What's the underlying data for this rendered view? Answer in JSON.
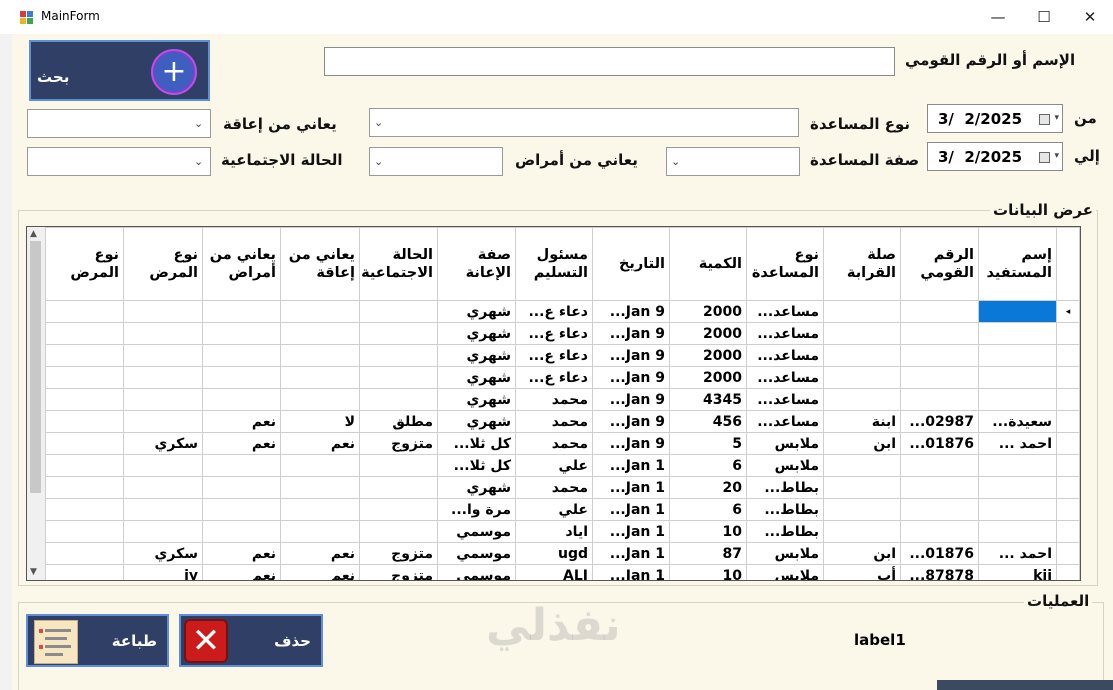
{
  "window": {
    "title": "MainForm",
    "minimize": "—",
    "maximize": "☐",
    "close": "✕"
  },
  "search": {
    "name_label": "الإسم أو الرقم القومي",
    "name_value": "",
    "button_label": "بحث",
    "from_label": "من",
    "to_label": "إلي",
    "from_date": "3/  2/2025",
    "to_date": "3/  2/2025",
    "aid_type_label": "نوع المساعدة",
    "aid_type_value": "",
    "aid_kind_label": "صفة المساعدة",
    "aid_kind_value": "",
    "disability_label": "يعاني من إعاقة",
    "disability_value": "",
    "disease_label": "يعاني من أمراض",
    "disease_value": "",
    "social_label": "الحالة الاجتماعية",
    "social_value": ""
  },
  "data_group_title": "عرض البيانات",
  "grid": {
    "columns": [
      "إسم المستفيد",
      "الرقم القومي",
      "صلة القرابة",
      "نوع المساعدة",
      "الكمية",
      "التاريخ",
      "مسئول التسليم",
      "صفة الإعانة",
      "الحالة الاجتماعية",
      "يعاني من إعاقة",
      "يعاني من أمراض",
      "نوع المرض",
      "نوع المرض"
    ],
    "rows": [
      [
        "",
        "",
        "",
        "مساعد...",
        "2000",
        "9  Jan...",
        "دعاء ع...",
        "شهري",
        "",
        "",
        "",
        "",
        ""
      ],
      [
        "",
        "",
        "",
        "مساعد...",
        "2000",
        "9  Jan...",
        "دعاء ع...",
        "شهري",
        "",
        "",
        "",
        "",
        ""
      ],
      [
        "",
        "",
        "",
        "مساعد...",
        "2000",
        "9  Jan...",
        "دعاء ع...",
        "شهري",
        "",
        "",
        "",
        "",
        ""
      ],
      [
        "",
        "",
        "",
        "مساعد...",
        "2000",
        "9  Jan...",
        "دعاء ع...",
        "شهري",
        "",
        "",
        "",
        "",
        ""
      ],
      [
        "",
        "",
        "",
        "مساعد...",
        "4345",
        "9  Jan...",
        "محمد",
        "شهري",
        "",
        "",
        "",
        "",
        ""
      ],
      [
        "سعيدة...",
        "02987...",
        "ابنة",
        "مساعد...",
        "456",
        "9  Jan...",
        "محمد",
        "شهري",
        "مطلق",
        "لا",
        "نعم",
        "",
        ""
      ],
      [
        "احمد ...",
        "01876...",
        "ابن",
        "ملابس",
        "5",
        "9  Jan...",
        "محمد",
        "كل ثلا...",
        "متزوج",
        "نعم",
        "نعم",
        "سكري",
        ""
      ],
      [
        "",
        "",
        "",
        "ملابس",
        "6",
        "1  Jan...",
        "علي",
        "كل ثلا...",
        "",
        "",
        "",
        "",
        ""
      ],
      [
        "",
        "",
        "",
        "بطاط...",
        "20",
        "1  Jan...",
        "محمد",
        "شهري",
        "",
        "",
        "",
        "",
        ""
      ],
      [
        "",
        "",
        "",
        "بطاط...",
        "6",
        "1  Jan...",
        "علي",
        "مرة وا...",
        "",
        "",
        "",
        "",
        ""
      ],
      [
        "",
        "",
        "",
        "بطاط...",
        "10",
        "1  Jan...",
        "اياد",
        "موسمي",
        "",
        "",
        "",
        "",
        ""
      ],
      [
        "احمد ...",
        "01876...",
        "ابن",
        "ملابس",
        "87",
        "1  Jan...",
        "ugd",
        "موسمي",
        "متزوج",
        "نعم",
        "نعم",
        "سكري",
        ""
      ],
      [
        "kii",
        "87878...",
        "أب",
        "ملابس",
        "10",
        "1  Jan...",
        "ALI",
        "موسمي",
        "متزوج",
        "نعم",
        "نعم",
        "jy",
        ""
      ]
    ]
  },
  "ops_group_title": "العمليات",
  "ops": {
    "delete_label": "حذف",
    "print_label": "طباعة",
    "status_label": "label1"
  },
  "watermark": "نفذلي",
  "colors": {
    "button_bg": "#2f3f66",
    "selected": "#0a78d7",
    "form_bg": "#fbf8ea"
  }
}
